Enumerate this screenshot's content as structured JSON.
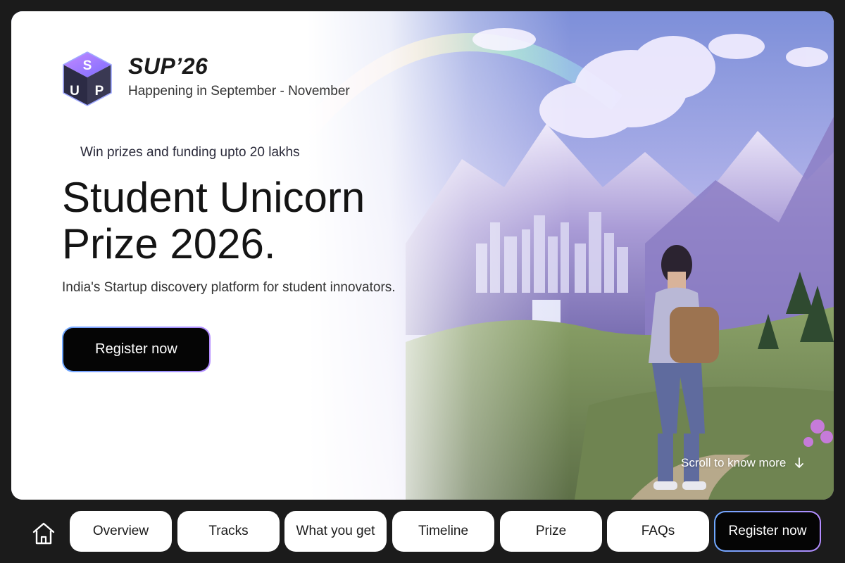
{
  "brand": {
    "title": "SUP’26",
    "subtitle": "Happening in September - November",
    "logo_letters": [
      "S",
      "U",
      "P"
    ]
  },
  "hero": {
    "eyebrow": "Win prizes and funding upto 20 lakhs",
    "headline_line1": "Student Unicorn",
    "headline_line2": "Prize 2026.",
    "tagline": "India's Startup discovery platform for student innovators.",
    "cta_label": "Register now",
    "scroll_hint": "Scroll to know more",
    "scroll_icon": "arrow-down-icon"
  },
  "nav": {
    "home_icon": "home-icon",
    "items": [
      "Overview",
      "Tracks",
      "What you get",
      "Timeline",
      "Prize",
      "FAQs"
    ],
    "register_label": "Register now"
  },
  "colors": {
    "background": "#1b1b1b",
    "cta_fill": "#050505",
    "cta_border_start": "#6fa8ff",
    "cta_border_end": "#b48cff"
  }
}
